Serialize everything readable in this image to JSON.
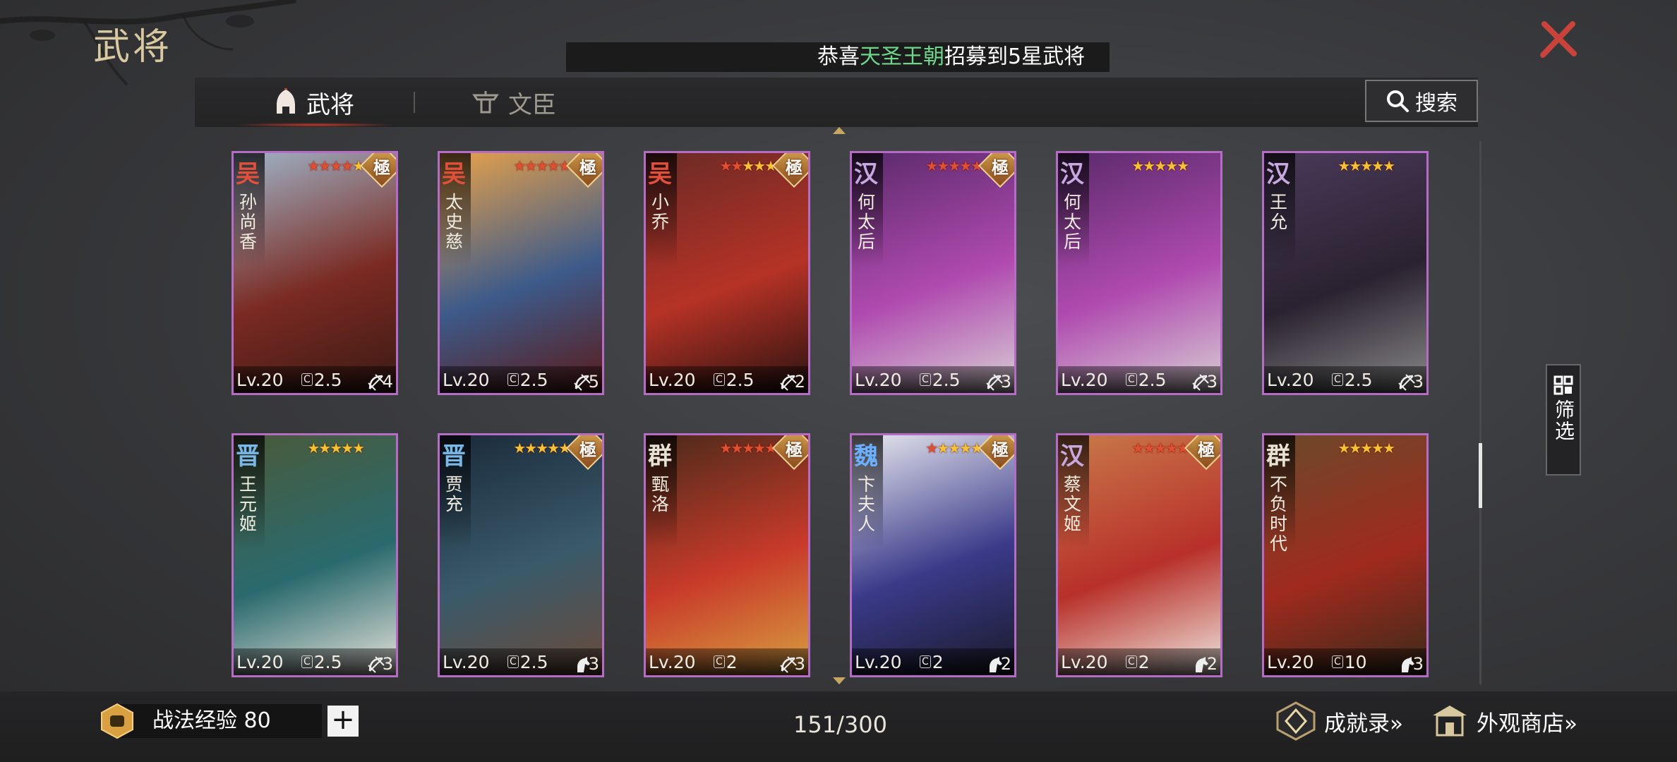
{
  "header": {
    "title": "武将",
    "ticker_prefix": "恭喜",
    "ticker_name": "天圣王朝",
    "ticker_suffix": "招募到5星武将"
  },
  "tabs": [
    {
      "label": "武将",
      "icon": "helmet-icon",
      "active": true
    },
    {
      "label": "文臣",
      "icon": "scholar-icon",
      "active": false
    }
  ],
  "search": {
    "label": "搜索",
    "icon": "search-icon"
  },
  "filter": {
    "label": "筛选",
    "icon": "grid-icon"
  },
  "colors": {
    "card_border": "#b46cc4",
    "ticker_highlight": "#6fd58a",
    "star": "#f4c430",
    "star_red": "#e05030"
  },
  "cards": [
    {
      "faction": "吴",
      "faction_color": "#e2503a",
      "name": "孙尚香",
      "stars": 5,
      "red_stars": 4,
      "ji": "極",
      "level": "Lv.20",
      "cost": "2.5",
      "unit": "bow-icon",
      "unit_count": "4",
      "art": [
        "#9fb4c8",
        "#7a2a22",
        "#3a1a14"
      ]
    },
    {
      "faction": "吴",
      "faction_color": "#e2503a",
      "name": "太史慈",
      "stars": 5,
      "red_stars": 5,
      "ji": "極",
      "level": "Lv.20",
      "cost": "2.5",
      "unit": "bow-icon",
      "unit_count": "5",
      "art": [
        "#e8a24a",
        "#3d5a8a",
        "#5a1a18"
      ]
    },
    {
      "faction": "吴",
      "faction_color": "#e2503a",
      "name": "小乔",
      "stars": 5,
      "red_stars": 2,
      "ji": "極",
      "level": "Lv.20",
      "cost": "2.5",
      "unit": "bow-icon",
      "unit_count": "2",
      "art": [
        "#6a2a26",
        "#b63226",
        "#2a1210"
      ]
    },
    {
      "faction": "汉",
      "faction_color": "#c8a8e0",
      "name": "何太后",
      "stars": 5,
      "red_stars": 5,
      "ji": "極",
      "level": "Lv.20",
      "cost": "2.5",
      "unit": "bow-icon",
      "unit_count": "3",
      "art": [
        "#5a2a6a",
        "#b04ab0",
        "#d8d0d4"
      ]
    },
    {
      "faction": "汉",
      "faction_color": "#c8a8e0",
      "name": "何太后",
      "stars": 5,
      "red_stars": 0,
      "ji": "",
      "level": "Lv.20",
      "cost": "2.5",
      "unit": "bow-icon",
      "unit_count": "3",
      "art": [
        "#5a2a6a",
        "#b04ab0",
        "#d8d0d4"
      ]
    },
    {
      "faction": "汉",
      "faction_color": "#c8a8e0",
      "name": "王允",
      "stars": 5,
      "red_stars": 0,
      "ji": "",
      "level": "Lv.20",
      "cost": "2.5",
      "unit": "bow-icon",
      "unit_count": "3",
      "art": [
        "#4a3a5a",
        "#2a2230",
        "#8a8a8a"
      ]
    },
    {
      "faction": "晋",
      "faction_color": "#7ab8e8",
      "name": "王元姬",
      "stars": 5,
      "red_stars": 0,
      "ji": "",
      "level": "Lv.20",
      "cost": "2.5",
      "unit": "bow-icon",
      "unit_count": "3",
      "art": [
        "#4a5a3a",
        "#2a6a6e",
        "#e8e4dc"
      ]
    },
    {
      "faction": "晋",
      "faction_color": "#7ab8e8",
      "name": "贾充",
      "stars": 5,
      "red_stars": 0,
      "ji": "極",
      "level": "Lv.20",
      "cost": "2.5",
      "unit": "horse-icon",
      "unit_count": "3",
      "art": [
        "#1a2a3a",
        "#3a5a6a",
        "#6a4a3a"
      ]
    },
    {
      "faction": "群",
      "faction_color": "#e8e2d4",
      "name": "甄洛",
      "stars": 5,
      "red_stars": 5,
      "ji": "極",
      "level": "Lv.20",
      "cost": "2",
      "unit": "bow-icon",
      "unit_count": "3",
      "art": [
        "#4a2a1a",
        "#c83a2a",
        "#d8a040"
      ]
    },
    {
      "faction": "魏",
      "faction_color": "#6ab0ff",
      "name": "卞夫人",
      "stars": 5,
      "red_stars": 1,
      "ji": "極",
      "level": "Lv.20",
      "cost": "2",
      "unit": "horse-icon",
      "unit_count": "2",
      "art": [
        "#e8e8f0",
        "#3a3a8a",
        "#1a1a2a"
      ]
    },
    {
      "faction": "汉",
      "faction_color": "#c8a8e0",
      "name": "蔡文姬",
      "stars": 5,
      "red_stars": 5,
      "ji": "極",
      "level": "Lv.20",
      "cost": "2",
      "unit": "horse-icon",
      "unit_count": "2",
      "art": [
        "#c87a4a",
        "#b8302a",
        "#f0e8e0"
      ]
    },
    {
      "faction": "群",
      "faction_color": "#e8e2d4",
      "name": "不负时代",
      "stars": 5,
      "red_stars": 0,
      "ji": "",
      "level": "Lv.20",
      "cost": "10",
      "unit": "horse-icon",
      "unit_count": "3",
      "art": [
        "#6a4a2a",
        "#a02a1e",
        "#3a2a1a"
      ]
    }
  ],
  "footer": {
    "exp_label": "战法经验 80",
    "plus": "+",
    "count": "151/300",
    "achievements": "成就录»",
    "appearance_shop": "外观商店»"
  }
}
